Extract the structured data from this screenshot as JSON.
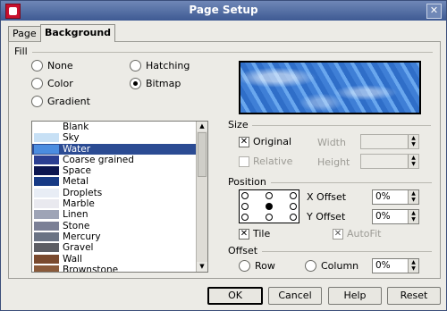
{
  "window": {
    "title": "Page Setup"
  },
  "tabs": [
    "Page",
    "Background"
  ],
  "fill": {
    "label": "Fill",
    "options": [
      "None",
      "Color",
      "Gradient",
      "Hatching",
      "Bitmap"
    ],
    "selected": "Bitmap"
  },
  "bitmaps": [
    {
      "name": "Blank",
      "swatch": "#ffffff"
    },
    {
      "name": "Sky",
      "swatch": "#c7e0f5"
    },
    {
      "name": "Water",
      "swatch": "#4b8de0"
    },
    {
      "name": "Coarse grained",
      "swatch": "#2b3f92"
    },
    {
      "name": "Space",
      "swatch": "#0c1650"
    },
    {
      "name": "Metal",
      "swatch": "#173a85"
    },
    {
      "name": "Droplets",
      "swatch": "#e8edf5"
    },
    {
      "name": "Marble",
      "swatch": "#e9e9ef"
    },
    {
      "name": "Linen",
      "swatch": "#9ea4b6"
    },
    {
      "name": "Stone",
      "swatch": "#7b8096"
    },
    {
      "name": "Mercury",
      "swatch": "#6a7384"
    },
    {
      "name": "Gravel",
      "swatch": "#5d5e64"
    },
    {
      "name": "Wall",
      "swatch": "#7a4a2e"
    },
    {
      "name": "Brownstone",
      "swatch": "#8a5a3a"
    }
  ],
  "bitmap_selected": "Water",
  "size": {
    "label": "Size",
    "original_label": "Original",
    "original_checked": true,
    "relative_label": "Relative",
    "relative_checked": false,
    "width_label": "Width",
    "height_label": "Height"
  },
  "position": {
    "label": "Position",
    "x_offset_label": "X Offset",
    "x_offset_value": "0%",
    "y_offset_label": "Y Offset",
    "y_offset_value": "0%",
    "tile_label": "Tile",
    "tile_checked": true,
    "autofit_label": "AutoFit",
    "autofit_checked": true
  },
  "offset": {
    "label": "Offset",
    "row_label": "Row",
    "column_label": "Column",
    "value": "0%"
  },
  "buttons": {
    "ok": "OK",
    "cancel": "Cancel",
    "help": "Help",
    "reset": "Reset"
  }
}
